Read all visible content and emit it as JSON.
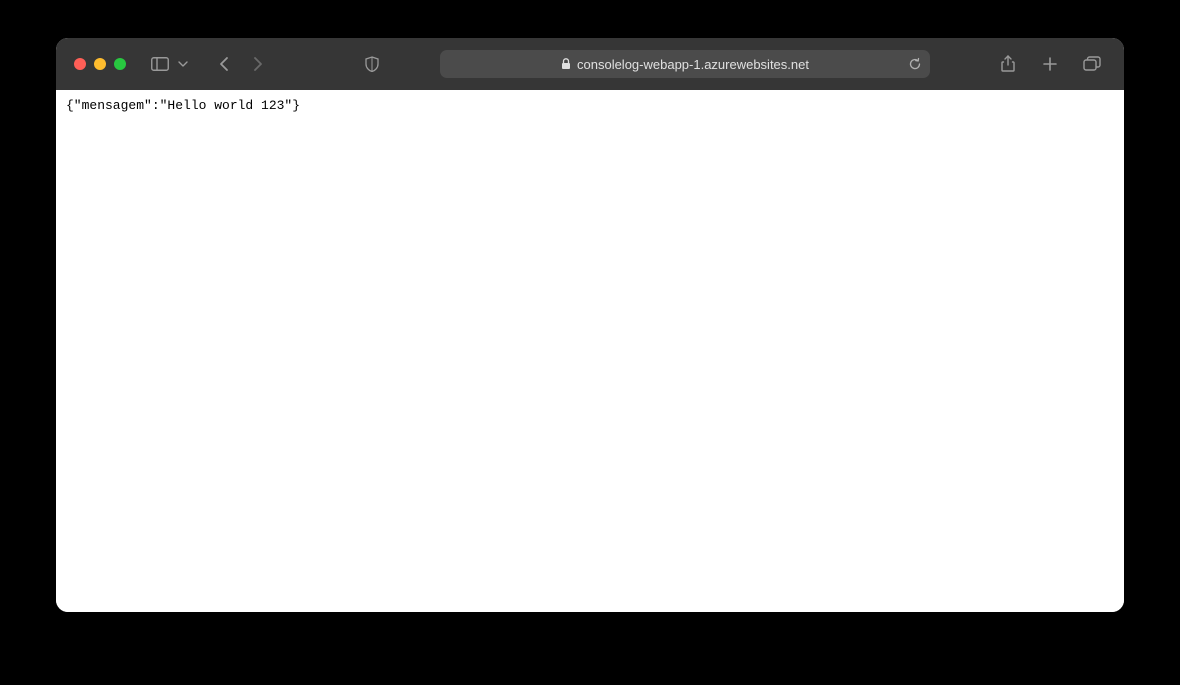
{
  "toolbar": {
    "url": "consolelog-webapp-1.azurewebsites.net"
  },
  "content": {
    "body": "{\"mensagem\":\"Hello world 123\"}"
  }
}
